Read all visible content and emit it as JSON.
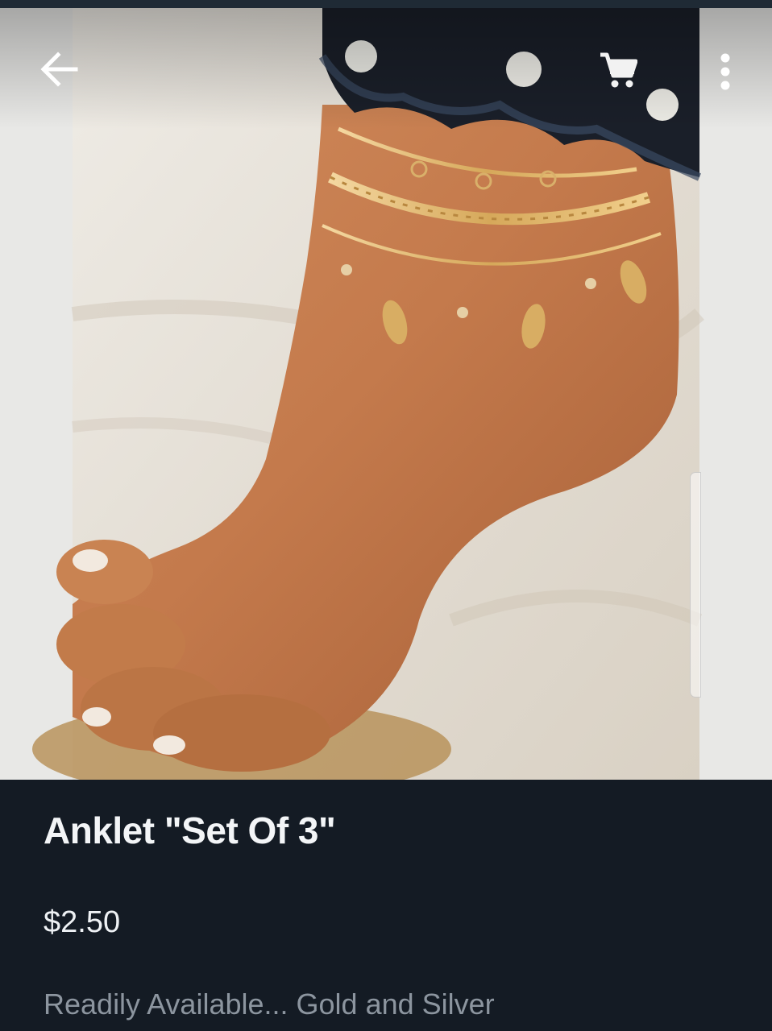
{
  "product": {
    "title": "Anklet \"Set Of 3\"",
    "price": "$2.50",
    "description": "Readily Available... Gold and Silver"
  },
  "toolbar": {
    "back_icon": "arrow-left-icon",
    "cart_icon": "shopping-cart-icon",
    "more_icon": "more-vertical-icon"
  },
  "colors": {
    "background": "#141b24",
    "title_text": "#f3f5f7",
    "description_text": "#8c959f"
  }
}
